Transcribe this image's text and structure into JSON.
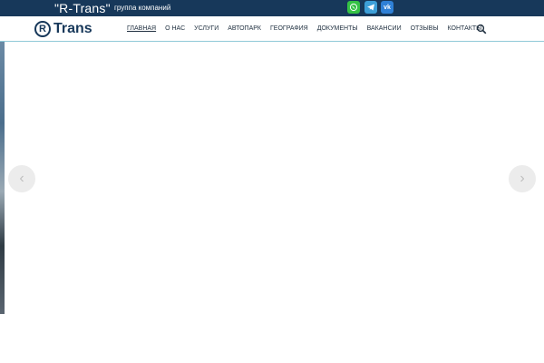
{
  "topbar": {
    "brand": "\"R-Trans\"",
    "tagline": "группа компаний",
    "social": [
      "whatsapp-icon",
      "telegram-icon",
      "vk-icon"
    ],
    "vk_label": "vk"
  },
  "logo": {
    "letter": "R",
    "text": "Trans"
  },
  "nav": {
    "items": [
      "ГЛАВНАЯ",
      "О НАС",
      "УСЛУГИ",
      "АВТОПАРК",
      "ГЕОГРАФИЯ",
      "ДОКУМЕНТЫ",
      "ВАКАНСИИ",
      "ОТЗЫВЫ",
      "КОНТАКТЫ"
    ],
    "active": "ГЛАВНАЯ"
  },
  "slider": {
    "prev_icon": "‹",
    "next_icon": "›"
  },
  "colors": {
    "topbar": "#17385a",
    "accent": "#17385a",
    "divider": "#8fc9d8"
  }
}
